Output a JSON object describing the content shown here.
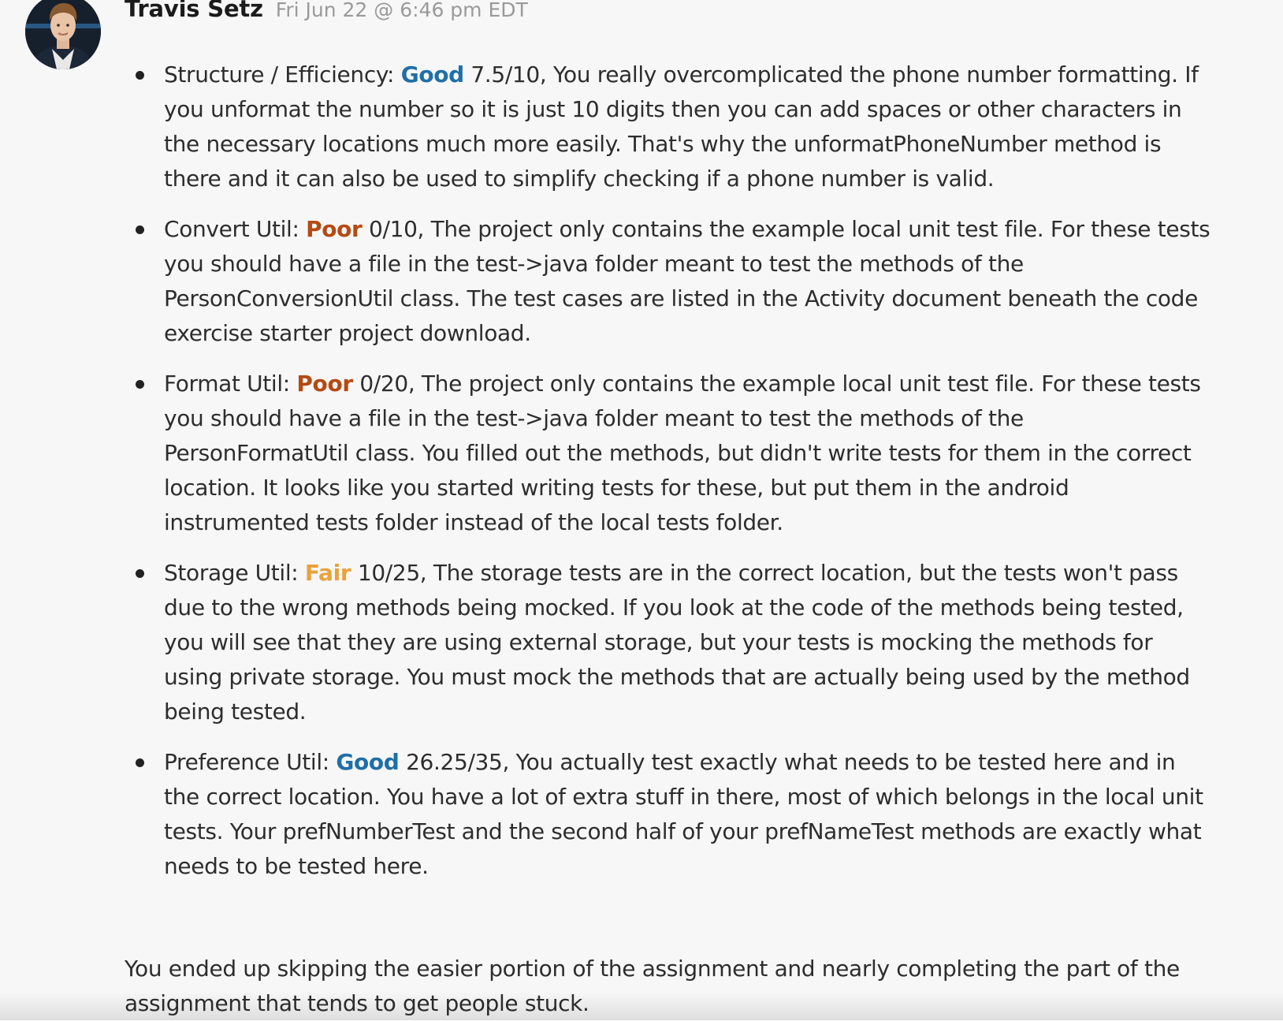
{
  "post": {
    "author": "Travis Setz",
    "timestamp": "Fri Jun 22 @ 6:46 pm EDT",
    "items": [
      {
        "label": "Structure / Efficiency: ",
        "rating": "Good",
        "rating_color": "#1e6fa8",
        "text": " 7.5/10, You really overcomplicated the phone number formatting. If you unformat the number so it is just 10 digits then you can add spaces or other characters in the necessary locations much more easily. That's why the unformatPhoneNumber method is there and it can also be used to simplify checking if a phone number is valid."
      },
      {
        "label": "Convert Util: ",
        "rating": "Poor",
        "rating_color": "#b54a12",
        "text": " 0/10, The project only contains the example local unit test file. For these tests you should have a file in the test->java folder meant to test the methods of the PersonConversionUtil class. The test cases are listed in the Activity document beneath the code exercise starter project download."
      },
      {
        "label": "Format Util: ",
        "rating": "Poor",
        "rating_color": "#b54a12",
        "text": " 0/20, The project only contains the example local unit test file. For these tests you should have a file in the test->java folder meant to test the methods of the PersonFormatUtil class. You filled out the methods, but didn't write tests for them in the correct location. It looks like you started writing tests for these, but put them in the android instrumented tests folder instead of the local tests folder."
      },
      {
        "label": "Storage Util: ",
        "rating": "Fair",
        "rating_color": "#e9a23b",
        "text": " 10/25, The storage tests are in the correct location, but the tests won't pass due to the wrong methods being mocked. If you look at the code of the methods being tested, you will see that they are using external storage, but your tests is mocking the methods for using private storage. You must mock the methods that are actually being used by the method being tested."
      },
      {
        "label": "Preference Util: ",
        "rating": "Good",
        "rating_color": "#1e6fa8",
        "text": " 26.25/35, You actually test exactly what needs to be tested here and in the correct location. You have a lot of extra stuff in there, most of which belongs in the local unit tests. Your prefNumberTest and the second half of your prefNameTest methods are exactly what needs to be tested here."
      }
    ],
    "summary": "You ended up skipping the easier portion of the assignment and nearly completing the part of the assignment that tends to get people stuck."
  }
}
